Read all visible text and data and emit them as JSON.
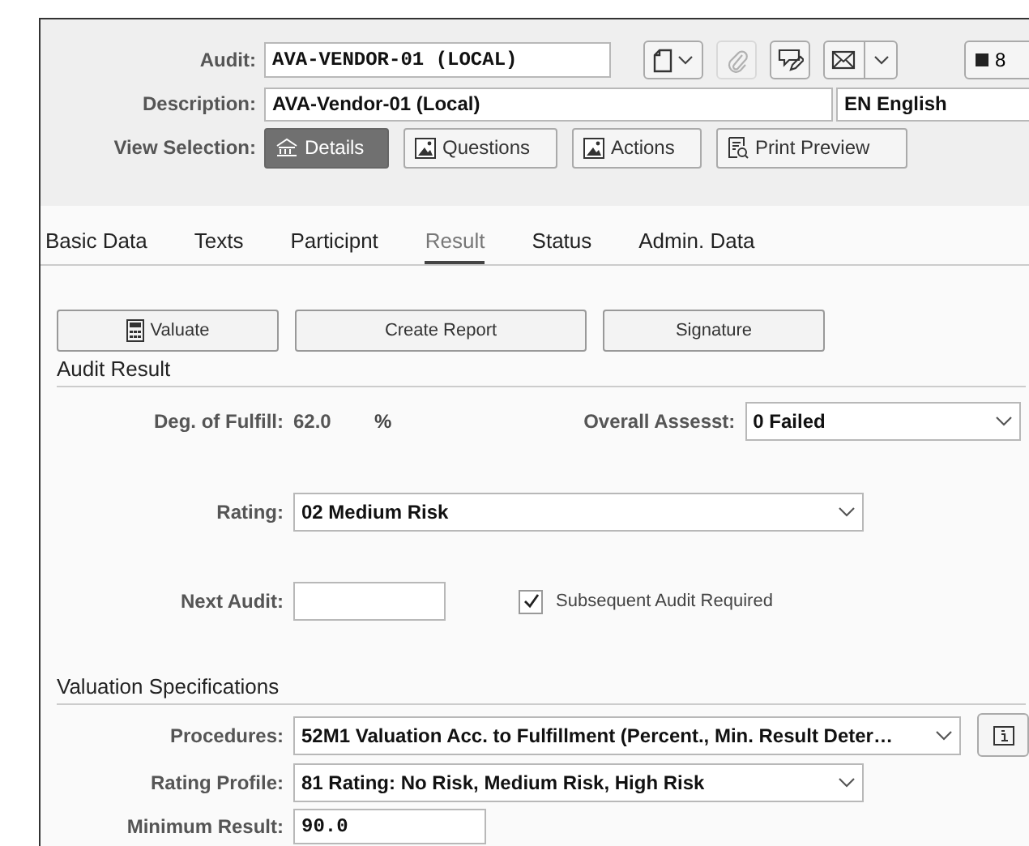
{
  "header": {
    "audit": {
      "label": "Audit:",
      "value": "AVA-VENDOR-01 (LOCAL)"
    },
    "toolbar": [
      {
        "kind": "document-menu",
        "disabled": false
      },
      {
        "kind": "attach",
        "disabled": true
      },
      {
        "kind": "note",
        "disabled": false
      },
      {
        "kind": "mail-menu",
        "disabled": false
      },
      {
        "kind": "counter",
        "disabled": false,
        "text": "8"
      }
    ],
    "description": {
      "label": "Description:",
      "value": "AVA-Vendor-01 (Local)",
      "language": "EN English"
    },
    "view_selection": {
      "label": "View Selection:",
      "buttons": [
        {
          "label": "Details",
          "kind": "details",
          "selected": true
        },
        {
          "label": "Questions",
          "kind": "image",
          "selected": false
        },
        {
          "label": "Actions",
          "kind": "image",
          "selected": false
        },
        {
          "label": "Print Preview",
          "kind": "preview",
          "selected": false
        }
      ]
    }
  },
  "tabs": [
    {
      "label": "Basic Data",
      "selected": false
    },
    {
      "label": "Texts",
      "selected": false
    },
    {
      "label": "Participnt",
      "selected": false
    },
    {
      "label": "Result",
      "selected": true
    },
    {
      "label": "Status",
      "selected": false
    },
    {
      "label": "Admin. Data",
      "selected": false
    }
  ],
  "actions": [
    {
      "label": "Valuate",
      "kind": "calculator"
    },
    {
      "label": "Create Report",
      "kind": "plain"
    },
    {
      "label": "Signature",
      "kind": "plain"
    }
  ],
  "audit_result": {
    "title": "Audit Result",
    "deg_of_fulfill": {
      "label": "Deg. of Fulfill:",
      "value": "62.0",
      "unit": "%"
    },
    "overall_assess": {
      "label": "Overall Assesst:",
      "value": "0 Failed"
    },
    "rating": {
      "label": "Rating:",
      "value": "02 Medium Risk"
    },
    "next_audit": {
      "label": "Next Audit:"
    },
    "subsequent": {
      "label": "Subsequent Audit Required",
      "checked": true
    }
  },
  "valuation": {
    "title": "Valuation Specifications",
    "procedures": {
      "label": "Procedures:",
      "value": "52M1 Valuation Acc. to Fulfillment (Percent., Min. Result Deter…"
    },
    "rating_profile": {
      "label": "Rating Profile:",
      "value": "81 Rating: No Risk, Medium Risk, High Risk"
    },
    "minimum_result": {
      "label": "Minimum Result:",
      "value": "90.0"
    }
  }
}
